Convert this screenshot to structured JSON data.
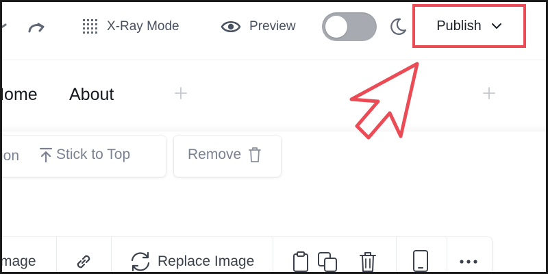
{
  "toolbar": {
    "xray_label": "X-Ray Mode",
    "preview_label": "Preview",
    "publish_label": "Publish",
    "icons": {
      "redo": "redo-icon",
      "xray": "grid-dots-icon",
      "preview": "eye-icon",
      "theme": "moon-icon",
      "publish_menu": "chevron-down-icon"
    },
    "dark_mode_on": false
  },
  "nav": {
    "items": [
      {
        "label": "Home"
      },
      {
        "label": "About"
      }
    ]
  },
  "section_actions": {
    "partial_label": "ion",
    "stick_to_top_label": "Stick to Top",
    "remove_label": "Remove"
  },
  "image_toolbar": {
    "partial_label": "mage",
    "replace_label": "Replace Image"
  },
  "colors": {
    "highlight": "#ea4b55",
    "toggle_off": "#a7abb1",
    "text_muted": "#7a8291",
    "text_dark": "#15181e"
  }
}
